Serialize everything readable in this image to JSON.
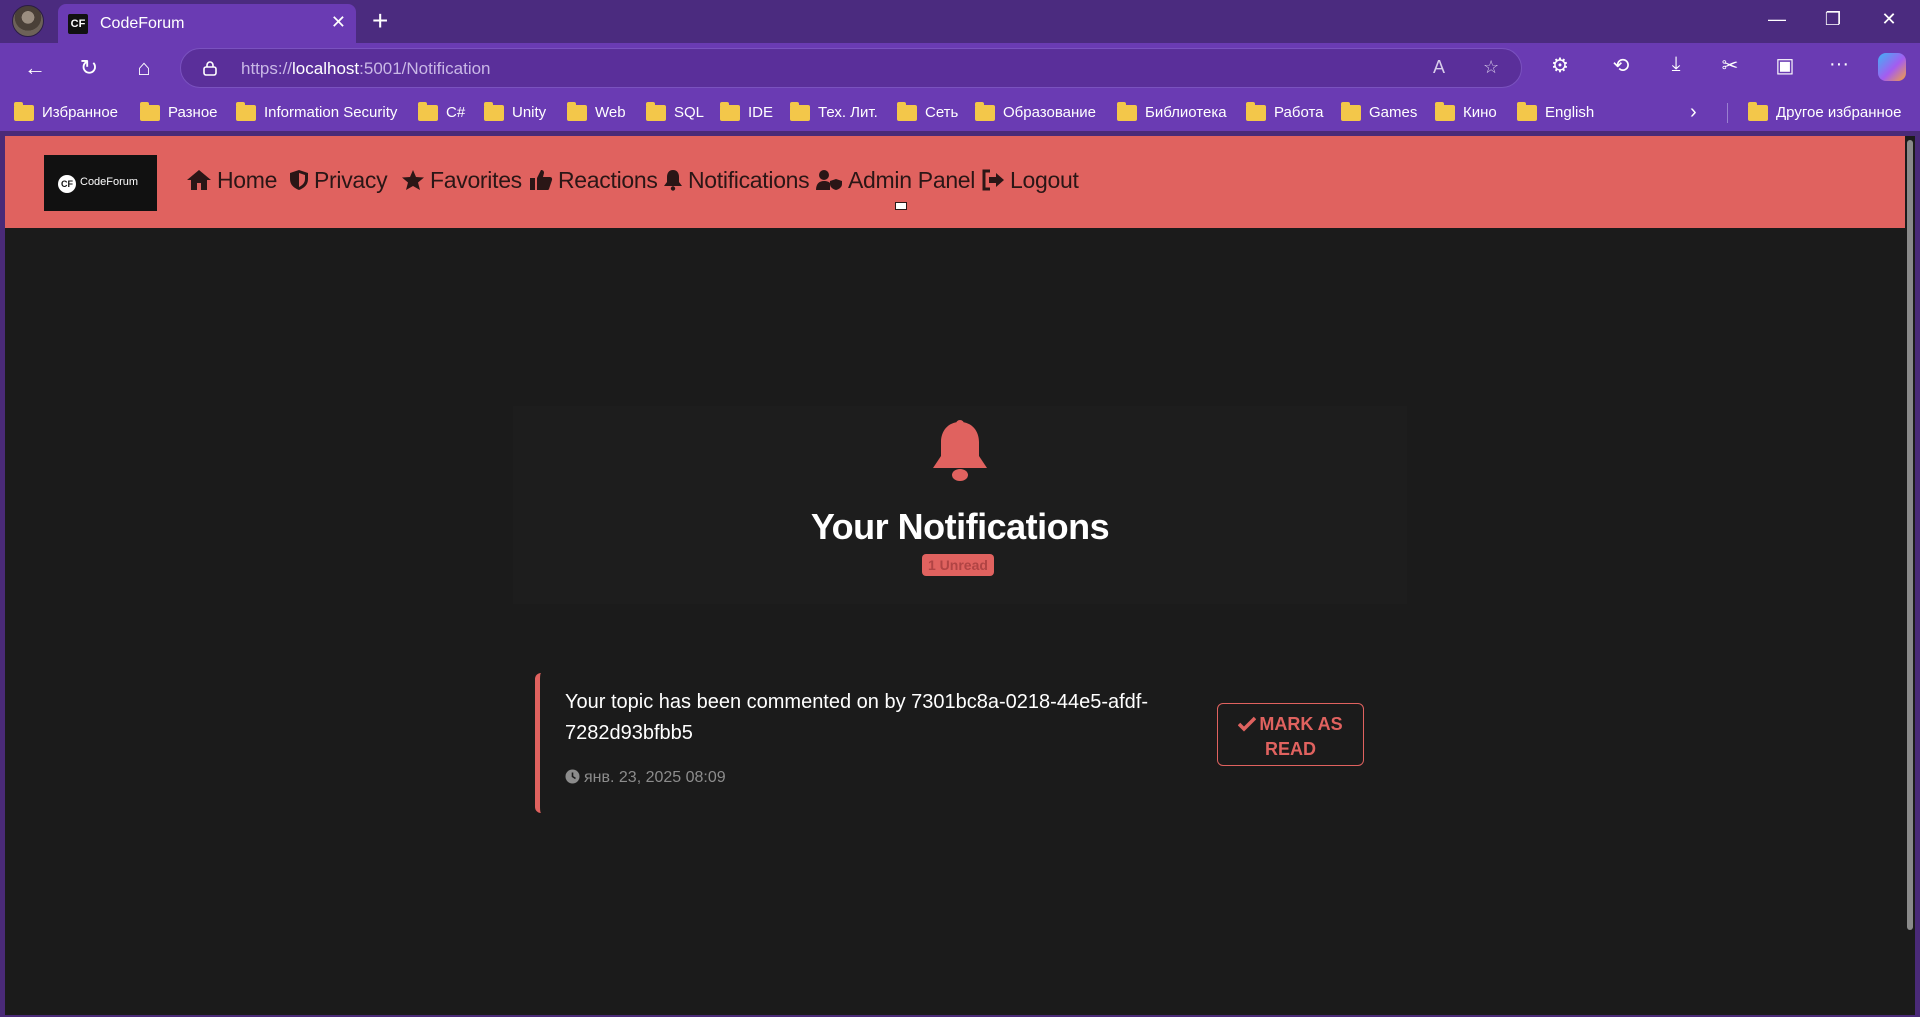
{
  "browser": {
    "tab_title": "CodeForum",
    "tab_favicon": "CF",
    "url_scheme": "https://",
    "url_host": "localhost",
    "url_rest": ":5001/Notification",
    "bookmarks": [
      "Избранное",
      "Разное",
      "Information Security",
      "C#",
      "Unity",
      "Web",
      "SQL",
      "IDE",
      "Тех. Лит.",
      "Сеть",
      "Образование",
      "Библиотека",
      "Работа",
      "Games",
      "Кино",
      "English"
    ],
    "other_bookmarks": "Другое избранное"
  },
  "site": {
    "logo_mark": "CF",
    "logo_text": "CodeForum",
    "nav": {
      "home": "Home",
      "privacy": "Privacy",
      "favorites": "Favorites",
      "reactions": "Reactions",
      "notifications": "Notifications",
      "admin": "Admin Panel",
      "logout": "Logout"
    }
  },
  "notifications": {
    "title": "Your Notifications",
    "unread_badge": "1 Unread",
    "items": [
      {
        "message": "Your topic has been commented on by 7301bc8a-0218-44e5-afdf-7282d93bfbb5",
        "timestamp": "янв. 23, 2025 08:09",
        "action_label": "MARK AS READ"
      }
    ]
  },
  "colors": {
    "accent": "#e0625f",
    "background": "#1b1b1b",
    "browser": "#6a3bb3"
  }
}
